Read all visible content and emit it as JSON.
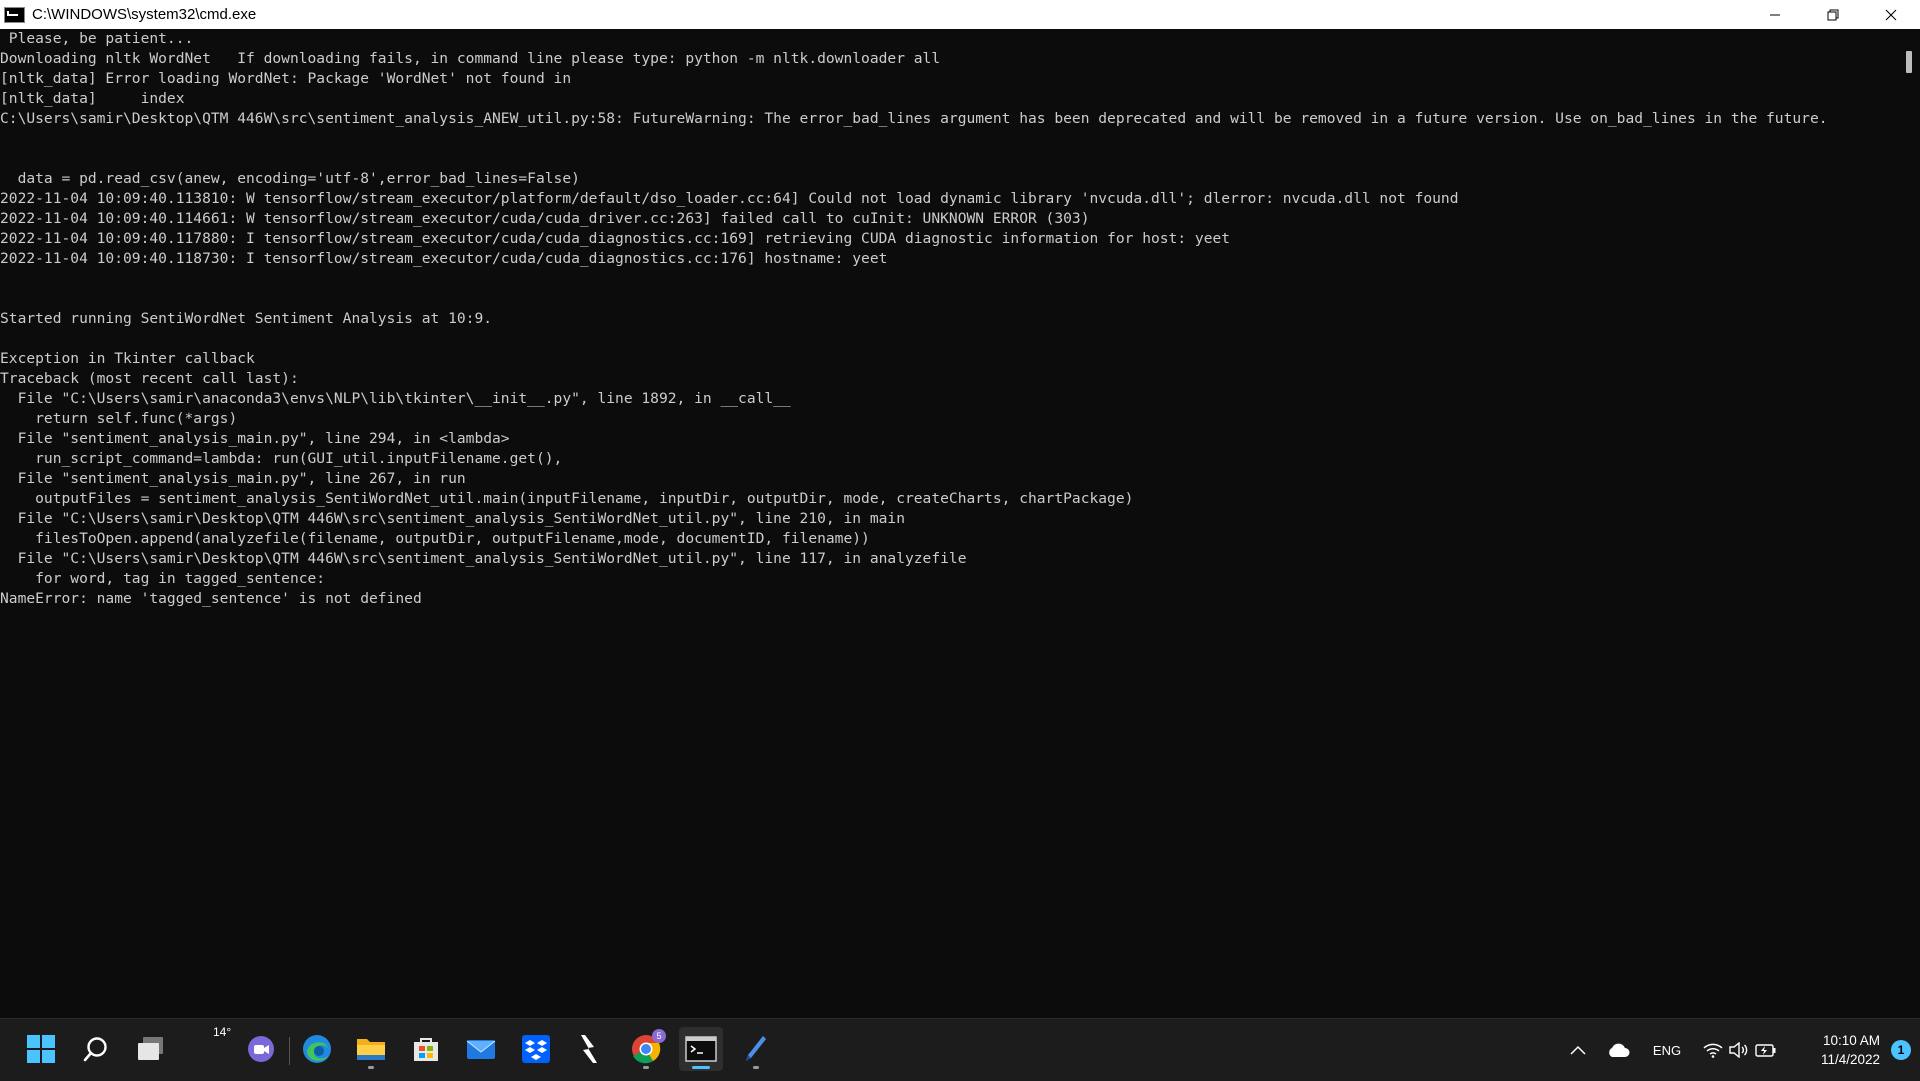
{
  "window": {
    "title": "C:\\WINDOWS\\system32\\cmd.exe",
    "controls": {
      "minimize": "minimize",
      "restore": "restore",
      "close": "close"
    }
  },
  "console": {
    "lines": [
      " Please, be patient...",
      "Downloading nltk WordNet   If downloading fails, in command line please type: python -m nltk.downloader all",
      "[nltk_data] Error loading WordNet: Package 'WordNet' not found in",
      "[nltk_data]     index",
      "C:\\Users\\samir\\Desktop\\QTM 446W\\src\\sentiment_analysis_ANEW_util.py:58: FutureWarning: The error_bad_lines argument has been deprecated and will be removed in a future version. Use on_bad_lines in the future.",
      "",
      "",
      "  data = pd.read_csv(anew, encoding='utf-8',error_bad_lines=False)",
      "2022-11-04 10:09:40.113810: W tensorflow/stream_executor/platform/default/dso_loader.cc:64] Could not load dynamic library 'nvcuda.dll'; dlerror: nvcuda.dll not found",
      "2022-11-04 10:09:40.114661: W tensorflow/stream_executor/cuda/cuda_driver.cc:263] failed call to cuInit: UNKNOWN ERROR (303)",
      "2022-11-04 10:09:40.117880: I tensorflow/stream_executor/cuda/cuda_diagnostics.cc:169] retrieving CUDA diagnostic information for host: yeet",
      "2022-11-04 10:09:40.118730: I tensorflow/stream_executor/cuda/cuda_diagnostics.cc:176] hostname: yeet",
      "",
      "",
      "Started running SentiWordNet Sentiment Analysis at 10:9.",
      "",
      "Exception in Tkinter callback",
      "Traceback (most recent call last):",
      "  File \"C:\\Users\\samir\\anaconda3\\envs\\NLP\\lib\\tkinter\\__init__.py\", line 1892, in __call__",
      "    return self.func(*args)",
      "  File \"sentiment_analysis_main.py\", line 294, in <lambda>",
      "    run_script_command=lambda: run(GUI_util.inputFilename.get(),",
      "  File \"sentiment_analysis_main.py\", line 267, in run",
      "    outputFiles = sentiment_analysis_SentiWordNet_util.main(inputFilename, inputDir, outputDir, mode, createCharts, chartPackage)",
      "  File \"C:\\Users\\samir\\Desktop\\QTM 446W\\src\\sentiment_analysis_SentiWordNet_util.py\", line 210, in main",
      "    filesToOpen.append(analyzefile(filename, outputDir, outputFilename,mode, documentID, filename))",
      "  File \"C:\\Users\\samir\\Desktop\\QTM 446W\\src\\sentiment_analysis_SentiWordNet_util.py\", line 117, in analyzefile",
      "    for word, tag in tagged_sentence:",
      "NameError: name 'tagged_sentence' is not defined"
    ]
  },
  "taskbar": {
    "apps": [
      {
        "name": "start",
        "icon": "windows-logo-icon"
      },
      {
        "name": "search",
        "icon": "search-icon"
      },
      {
        "name": "task-view",
        "icon": "task-view-icon"
      },
      {
        "name": "weather",
        "icon": "weather-icon",
        "label": "14°"
      },
      {
        "name": "teams-chat",
        "icon": "chat-icon"
      },
      {
        "name": "edge",
        "icon": "edge-icon"
      },
      {
        "name": "file-explorer",
        "icon": "folder-icon"
      },
      {
        "name": "store",
        "icon": "store-icon"
      },
      {
        "name": "mail",
        "icon": "mail-icon"
      },
      {
        "name": "dropbox",
        "icon": "dropbox-icon"
      },
      {
        "name": "slack-like",
        "icon": "lightning-icon"
      },
      {
        "name": "chrome",
        "icon": "chrome-icon",
        "badge": "5"
      },
      {
        "name": "terminal",
        "icon": "terminal-icon",
        "active": true
      },
      {
        "name": "pen",
        "icon": "pen-icon"
      }
    ],
    "weather_temp": "14°",
    "chrome_badge": "5",
    "tray": {
      "language": "ENG",
      "time": "10:10 AM",
      "date": "11/4/2022",
      "notification_count": "1"
    }
  },
  "colors": {
    "console_bg": "#0c0c0c",
    "console_fg": "#cccccc",
    "taskbar_bg": "#1c1c1c",
    "accent": "#4cc2ff"
  }
}
